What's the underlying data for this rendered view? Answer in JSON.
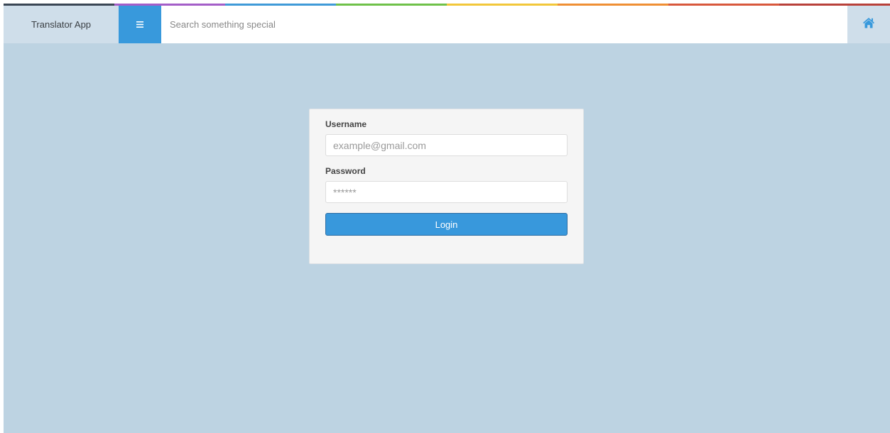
{
  "app": {
    "title": "Translator App"
  },
  "colors": {
    "rainbow": [
      "#3a4654",
      "#a45ec8",
      "#3f9ad8",
      "#6fc14a",
      "#f2c73a",
      "#ef8f34",
      "#d8583c",
      "#b8413a"
    ],
    "accent": "#3899dc",
    "navbar_border": "#2a5078",
    "background": "#bdd3e2"
  },
  "navbar": {
    "menu_icon": "hamburger-icon",
    "search_placeholder": "Search something special",
    "home_icon": "home-icon"
  },
  "login": {
    "username_label": "Username",
    "username_placeholder": "example@gmail.com",
    "password_label": "Password",
    "password_placeholder": "******",
    "login_button": "Login"
  }
}
